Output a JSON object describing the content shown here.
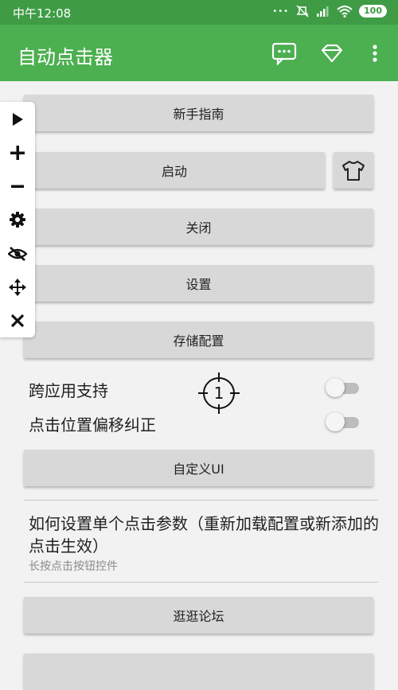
{
  "status_bar": {
    "time": "中午12:08",
    "battery": "100"
  },
  "app_bar": {
    "title": "自动点击器",
    "icons": [
      "message-icon",
      "diamond-icon",
      "more-vert-icon"
    ]
  },
  "buttons": {
    "guide": "新手指南",
    "start": "启动",
    "close": "关闭",
    "settings": "设置",
    "save_config": "存储配置",
    "custom_ui": "自定义UI",
    "forum": "逛逛论坛"
  },
  "toggles": {
    "cross_app": {
      "label": "跨应用支持",
      "on": false
    },
    "offset_fix": {
      "label": "点击位置偏移纠正",
      "on": false
    }
  },
  "target": {
    "number": "1"
  },
  "floating_panel": {
    "icons": [
      "play-icon",
      "plus-icon",
      "minus-icon",
      "gear-icon",
      "eye-off-icon",
      "move-icon",
      "close-icon"
    ]
  },
  "info": {
    "title": "如何设置单个点击参数（重新加载配置或新添加的点击生效）",
    "subtitle": "长按点击按钮控件"
  },
  "colors": {
    "app_bar": "#4caf50",
    "status_bar": "#3f9c45",
    "button_bg": "#d8d8d8",
    "background": "#f2f2f2"
  }
}
